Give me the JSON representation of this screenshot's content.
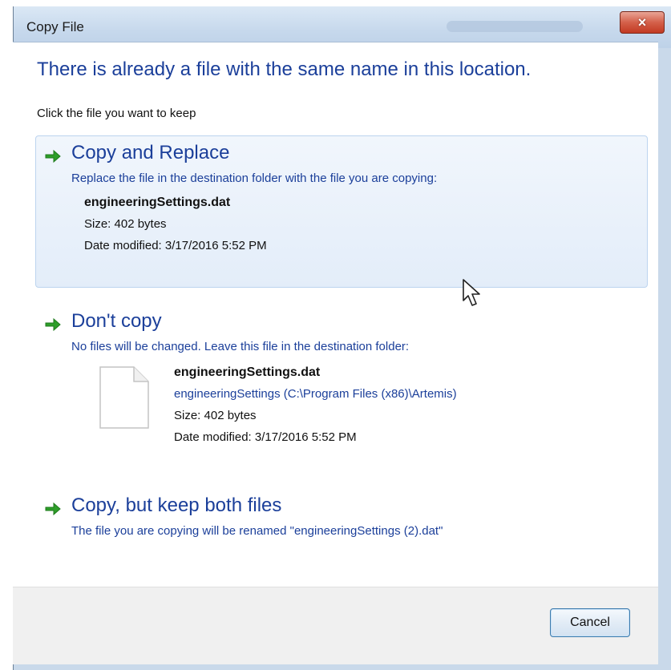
{
  "window": {
    "title": "Copy File",
    "close_label": "×"
  },
  "dialog": {
    "main_instruction": "There is already a file with the same name in this location.",
    "sub_instruction": "Click the file you want to keep",
    "options": [
      {
        "title": "Copy and Replace",
        "description": "Replace the file in the destination folder with the file you are copying:",
        "file_name": "engineeringSettings.dat",
        "size": "Size: 402 bytes",
        "date_modified": "Date modified: 3/17/2016 5:52 PM",
        "selected": true
      },
      {
        "title": "Don't copy",
        "description": "No files will be changed. Leave this file in the destination folder:",
        "file_name": "engineeringSettings.dat",
        "location": "engineeringSettings (C:\\Program Files (x86)\\Artemis)",
        "size": "Size: 402 bytes",
        "date_modified": "Date modified: 3/17/2016 5:52 PM",
        "selected": false
      },
      {
        "title": "Copy, but keep both files",
        "description": "The file you are copying will be renamed \"engineeringSettings (2).dat\"",
        "selected": false
      }
    ],
    "cancel_label": "Cancel"
  },
  "icons": {
    "option_arrow": "green-arrow-icon",
    "file": "file-icon",
    "pointer": "mouse-cursor-icon"
  },
  "colors": {
    "accent_text": "#1b3f9a",
    "arrow_green": "#2e9e2a",
    "selected_bg": "#e3edf9",
    "close_red": "#c23a22"
  }
}
